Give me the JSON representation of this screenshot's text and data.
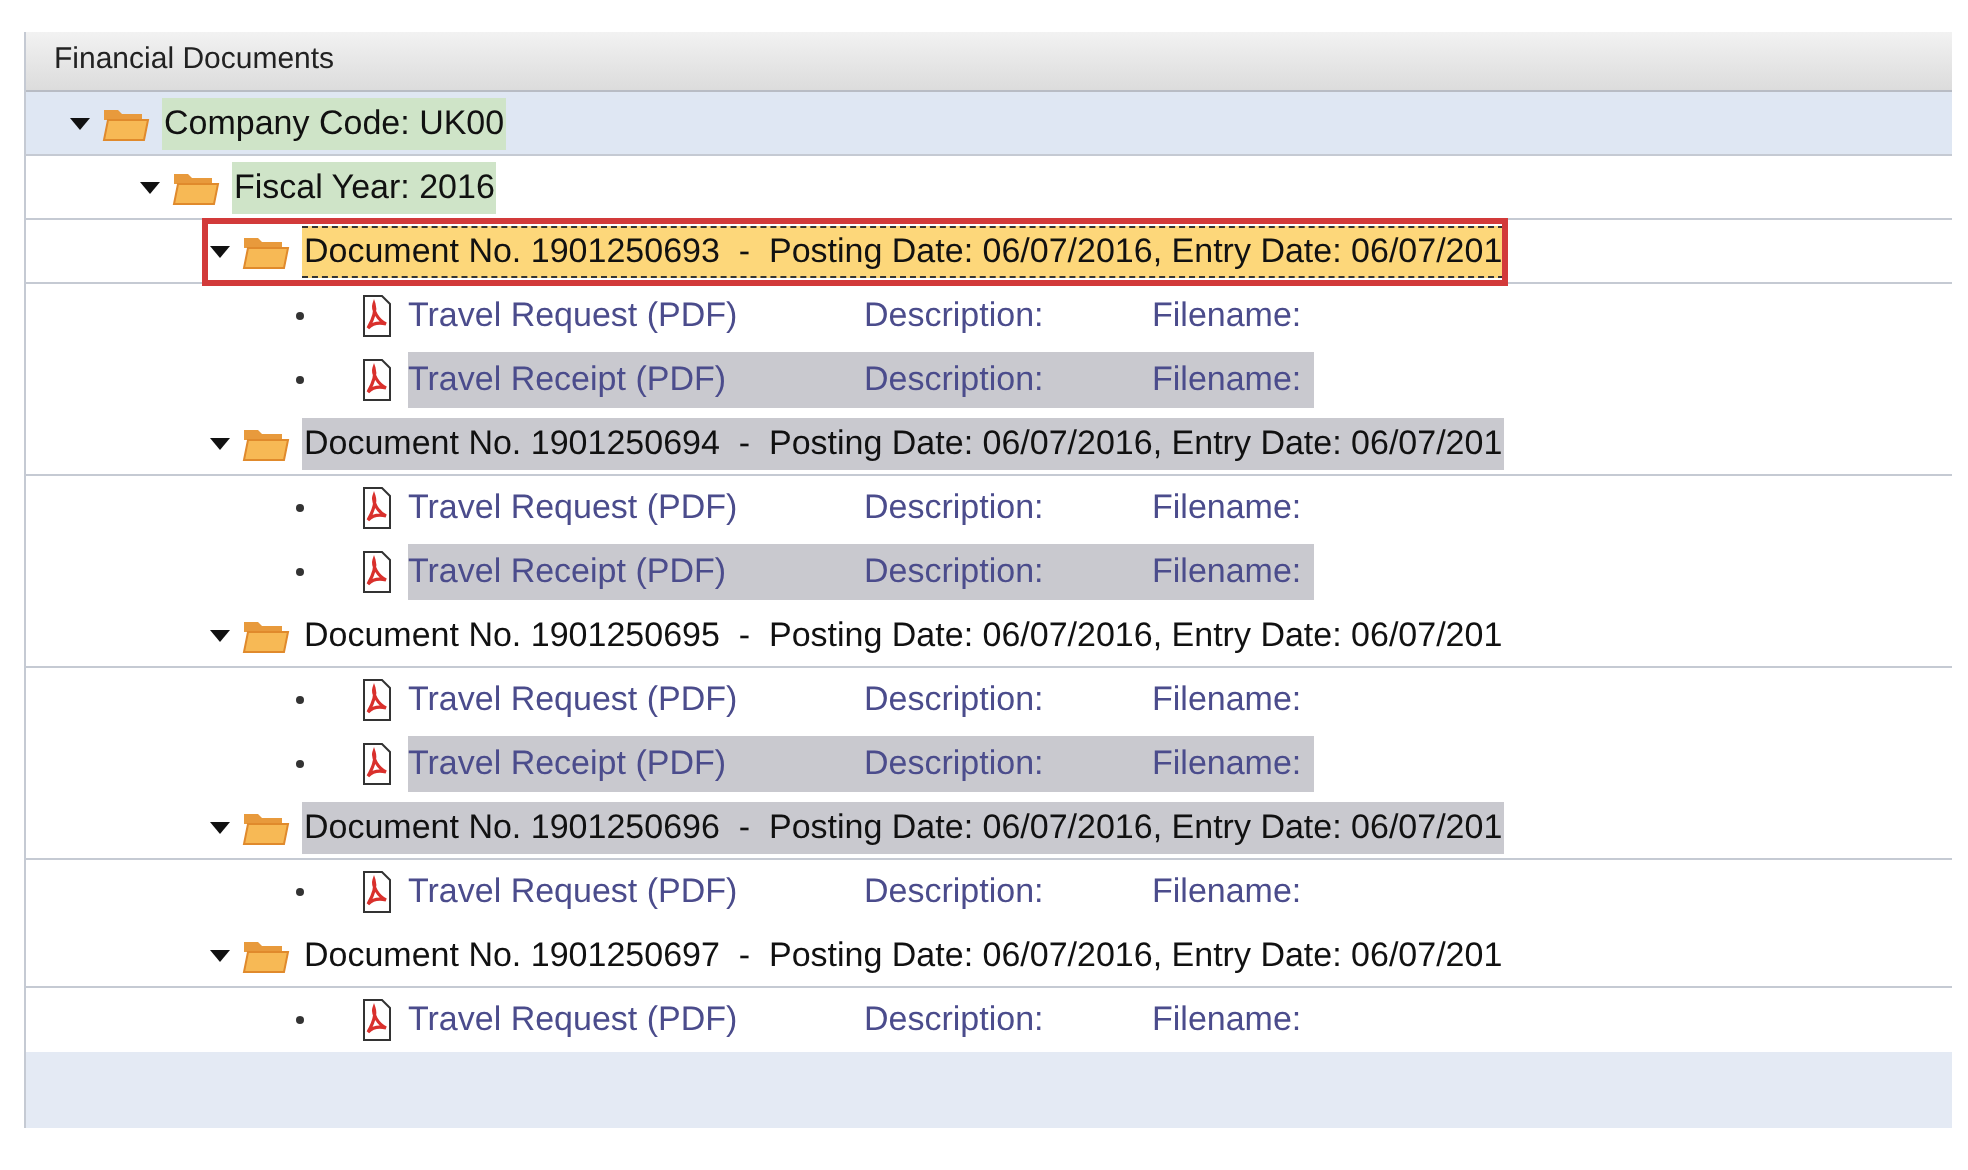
{
  "panel": {
    "title": "Financial Documents"
  },
  "tree": [
    {
      "label": "Company Code: UK00",
      "expanded": true,
      "highlighted": true,
      "children": [
        {
          "label": "Fiscal Year: 2016",
          "expanded": true,
          "highlighted": true,
          "children": [
            {
              "label": "Document No. 1901250693  -  Posting Date: 06/07/2016, Entry Date: 06/07/201",
              "expanded": true,
              "selected": true,
              "marked": true,
              "children": [
                {
                  "kind": "attachment",
                  "title": "Travel Request (PDF)",
                  "description": "Description:",
                  "filename": "Filename:",
                  "highlighted": false
                },
                {
                  "kind": "attachment",
                  "title": "Travel Receipt (PDF)",
                  "description": "Description:",
                  "filename": "Filename:",
                  "highlighted": true
                }
              ]
            },
            {
              "label": "Document No. 1901250694  -  Posting Date: 06/07/2016, Entry Date: 06/07/201",
              "expanded": true,
              "selected": false,
              "highlighted": true,
              "marked": false,
              "children": [
                {
                  "kind": "attachment",
                  "title": "Travel Request (PDF)",
                  "description": "Description:",
                  "filename": "Filename:",
                  "highlighted": false
                },
                {
                  "kind": "attachment",
                  "title": "Travel Receipt (PDF)",
                  "description": "Description:",
                  "filename": "Filename:",
                  "highlighted": true
                }
              ]
            },
            {
              "label": "Document No. 1901250695  -  Posting Date: 06/07/2016, Entry Date: 06/07/201",
              "expanded": true,
              "selected": false,
              "highlighted": false,
              "marked": false,
              "children": [
                {
                  "kind": "attachment",
                  "title": "Travel Request (PDF)",
                  "description": "Description:",
                  "filename": "Filename:",
                  "highlighted": false
                },
                {
                  "kind": "attachment",
                  "title": "Travel Receipt (PDF)",
                  "description": "Description:",
                  "filename": "Filename:",
                  "highlighted": true
                }
              ]
            },
            {
              "label": "Document No. 1901250696  -  Posting Date: 06/07/2016, Entry Date: 06/07/201",
              "expanded": true,
              "selected": false,
              "highlighted": true,
              "marked": false,
              "children": [
                {
                  "kind": "attachment",
                  "title": "Travel Request (PDF)",
                  "description": "Description:",
                  "filename": "Filename:",
                  "highlighted": false
                }
              ]
            },
            {
              "label": "Document No. 1901250697  -  Posting Date: 06/07/2016, Entry Date: 06/07/201",
              "expanded": true,
              "selected": false,
              "highlighted": false,
              "marked": false,
              "children": [
                {
                  "kind": "attachment",
                  "title": "Travel Request (PDF)",
                  "description": "Description:",
                  "filename": "Filename:",
                  "highlighted": false
                }
              ]
            }
          ]
        }
      ]
    }
  ]
}
